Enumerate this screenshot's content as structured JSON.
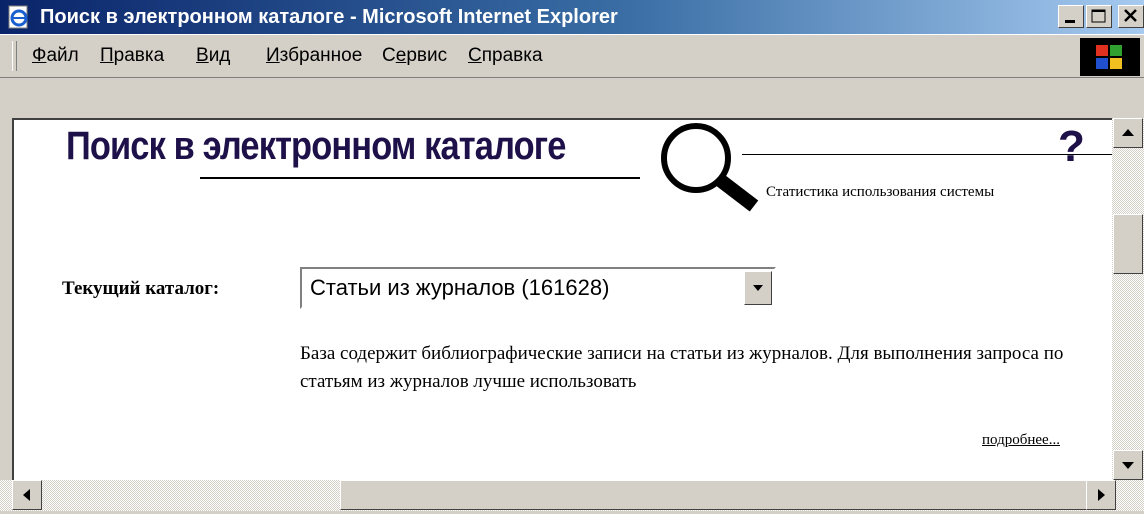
{
  "window": {
    "title": "Поиск в электронном каталоге - Microsoft Internet Explorer"
  },
  "menu": {
    "items": [
      {
        "mnemonic": "Ф",
        "rest": "айл"
      },
      {
        "mnemonic": "П",
        "rest": "равка"
      },
      {
        "mnemonic": "В",
        "rest": "ид"
      },
      {
        "mnemonic": "И",
        "rest": "збранное"
      },
      {
        "pre": "С",
        "mnemonic": "е",
        "rest": "рвис"
      },
      {
        "mnemonic": "С",
        "rest": "правка"
      }
    ]
  },
  "page": {
    "title": "Поиск в электронном каталоге",
    "help": "?",
    "stats_link": "Статистика использования системы",
    "catalog_label": "Текущий каталог:",
    "catalog_value": "Статьи из журналов (161628)",
    "description": "База содержит библиографические записи на статьи из журналов. Для выполнения запроса по статьям из журналов лучше использовать",
    "more_link": "подробнее..."
  },
  "icons": {
    "title": "ie-page-icon",
    "minimize": "minimize-icon",
    "maximize": "maximize-icon",
    "close": "close-icon",
    "magnifier": "magnifier-icon"
  }
}
